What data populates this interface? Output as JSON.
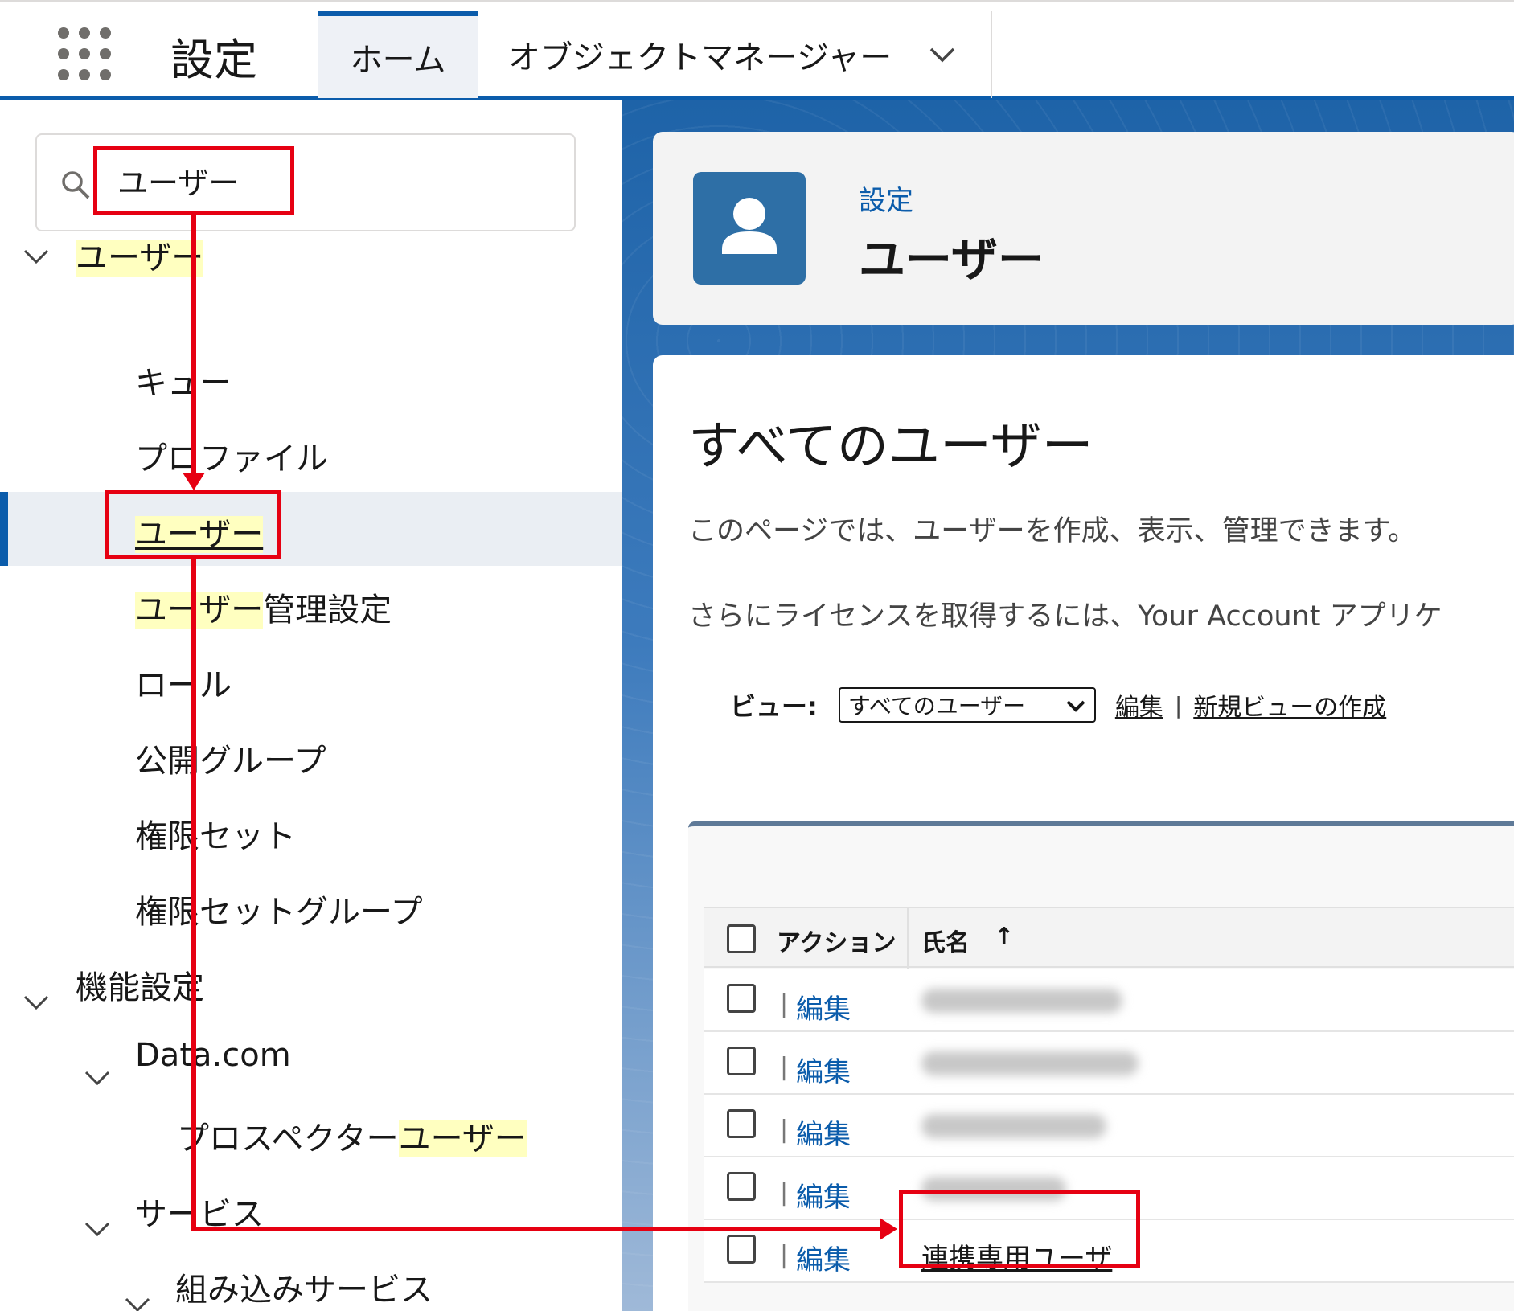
{
  "topbar": {
    "app_name": "設定",
    "tabs": [
      {
        "label": "ホーム"
      },
      {
        "label": "オブジェクトマネージャー"
      }
    ]
  },
  "sidebar": {
    "search_value": "ユーザー",
    "tree": {
      "users_group": "ユーザー",
      "queue": "キュー",
      "profile": "プロファイル",
      "users": "ユーザー",
      "user_mgmt_hl": "ユーザー",
      "user_mgmt_rest": "管理設定",
      "role": "ロール",
      "public_group": "公開グループ",
      "perm_set": "権限セット",
      "perm_set_group": "権限セットグループ",
      "feature_settings": "機能設定",
      "data_com": "Data.com",
      "prospector_prefix": "プロスペクター",
      "prospector_hl": "ユーザー",
      "service": "サービス",
      "embedded_service": "組み込みサービス"
    }
  },
  "header": {
    "breadcrumb": "設定",
    "title": "ユーザー"
  },
  "content": {
    "heading": "すべてのユーザー",
    "description_1": "このページでは、ユーザーを作成、表示、管理できます。",
    "description_2": "さらにライセンスを取得するには、Your Account アプリケ",
    "view_label": "ビュー:",
    "view_selected": "すべてのユーザー",
    "edit_link": "編集",
    "separator": "|",
    "new_view_link": "新規ビューの作成"
  },
  "table": {
    "columns": [
      "アクション",
      "氏名"
    ],
    "sort_indicator": "↑",
    "row_separator": "|",
    "edit_label": "編集",
    "rows": [
      {
        "name": ""
      },
      {
        "name": ""
      },
      {
        "name": ""
      },
      {
        "name": ""
      },
      {
        "name": "連携専用ユーザ"
      }
    ]
  },
  "colors": {
    "brand": "#0b5cab",
    "annotation": "#e60012",
    "highlight": "#ffffc0"
  }
}
